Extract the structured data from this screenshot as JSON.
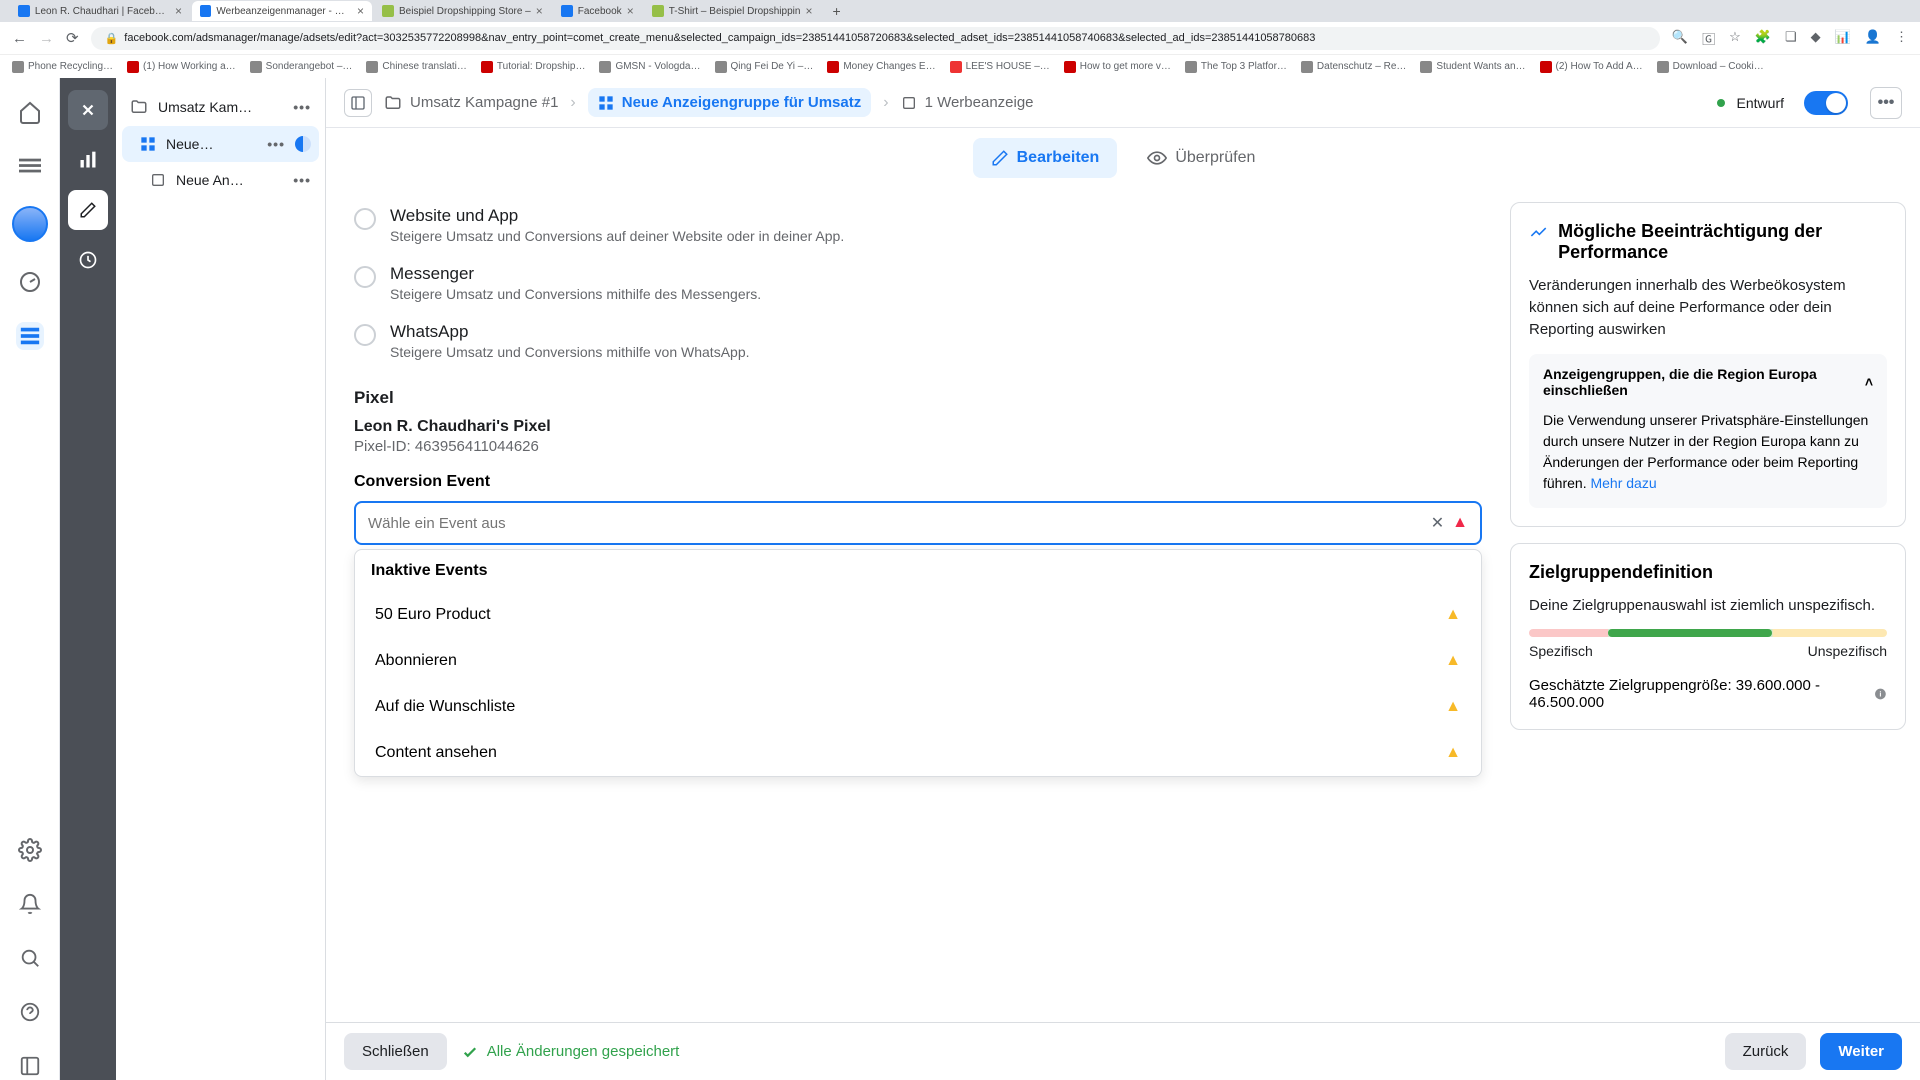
{
  "browser": {
    "tabs": [
      {
        "title": "Leon R. Chaudhari | Facebook"
      },
      {
        "title": "Werbeanzeigenmanager - We…"
      },
      {
        "title": "Beispiel Dropshipping Store –"
      },
      {
        "title": "Facebook"
      },
      {
        "title": "T-Shirt – Beispiel Dropshippin"
      }
    ],
    "url": "facebook.com/adsmanager/manage/adsets/edit?act=3032535772208998&nav_entry_point=comet_create_menu&selected_campaign_ids=23851441058720683&selected_adset_ids=23851441058740683&selected_ad_ids=23851441058780683",
    "bookmarks": [
      "Phone Recycling…",
      "(1) How Working a…",
      "Sonderangebot –…",
      "Chinese translati…",
      "Tutorial: Dropship…",
      "GMSN - Vologda…",
      "Qing Fei De Yi –…",
      "Money Changes E…",
      "LEE'S HOUSE –…",
      "How to get more v…",
      "The Top 3 Platfor…",
      "Datenschutz – Re…",
      "Student Wants an…",
      "(2) How To Add A…",
      "Download – Cooki…"
    ]
  },
  "tree": {
    "campaign": "Umsatz Kam…",
    "adset": "Neue…",
    "ad": "Neue An…"
  },
  "crumbs": {
    "campaign": "Umsatz Kampagne #1",
    "adset": "Neue Anzeigengruppe für Umsatz",
    "ad": "1 Werbeanzeige",
    "status": "Entwurf"
  },
  "modes": {
    "edit": "Bearbeiten",
    "review": "Überprüfen"
  },
  "conversion_location": {
    "website_app": {
      "title": "Website und App",
      "desc": "Steigere Umsatz und Conversions auf deiner Website oder in deiner App."
    },
    "messenger": {
      "title": "Messenger",
      "desc": "Steigere Umsatz und Conversions mithilfe des Messengers."
    },
    "whatsapp": {
      "title": "WhatsApp",
      "desc": "Steigere Umsatz und Conversions mithilfe von WhatsApp."
    }
  },
  "pixel": {
    "header": "Pixel",
    "name": "Leon R. Chaudhari's Pixel",
    "id_label": "Pixel-ID: 463956411044626"
  },
  "event": {
    "label": "Conversion Event",
    "placeholder": "Wähle ein Event aus",
    "group": "Inaktive Events",
    "items": [
      "50 Euro Product",
      "Abonnieren",
      "Auf die Wunschliste",
      "Content ansehen"
    ]
  },
  "right": {
    "perf_title": "Mögliche Beeinträchtigung der Performance",
    "perf_body": "Veränderungen innerhalb des Werbeökosystem können sich auf deine Performance oder dein Reporting auswirken",
    "euro_hdr": "Anzeigengruppen, die die Region Europa einschließen",
    "euro_body": "Die Verwendung unserer Privatsphäre-Einstellungen durch unsere Nutzer in der Region Europa kann zu Änderungen der Performance oder beim Reporting führen. ",
    "more": "Mehr dazu",
    "aud_title": "Zielgruppendefinition",
    "aud_body": "Deine Zielgruppenauswahl ist ziemlich unspezifisch.",
    "specific": "Spezifisch",
    "unspecific": "Unspezifisch",
    "estimate": "Geschätzte Zielgruppengröße: 39.600.000 - 46.500.000"
  },
  "footer": {
    "close": "Schließen",
    "saved": "Alle Änderungen gespeichert",
    "back": "Zurück",
    "next": "Weiter"
  }
}
